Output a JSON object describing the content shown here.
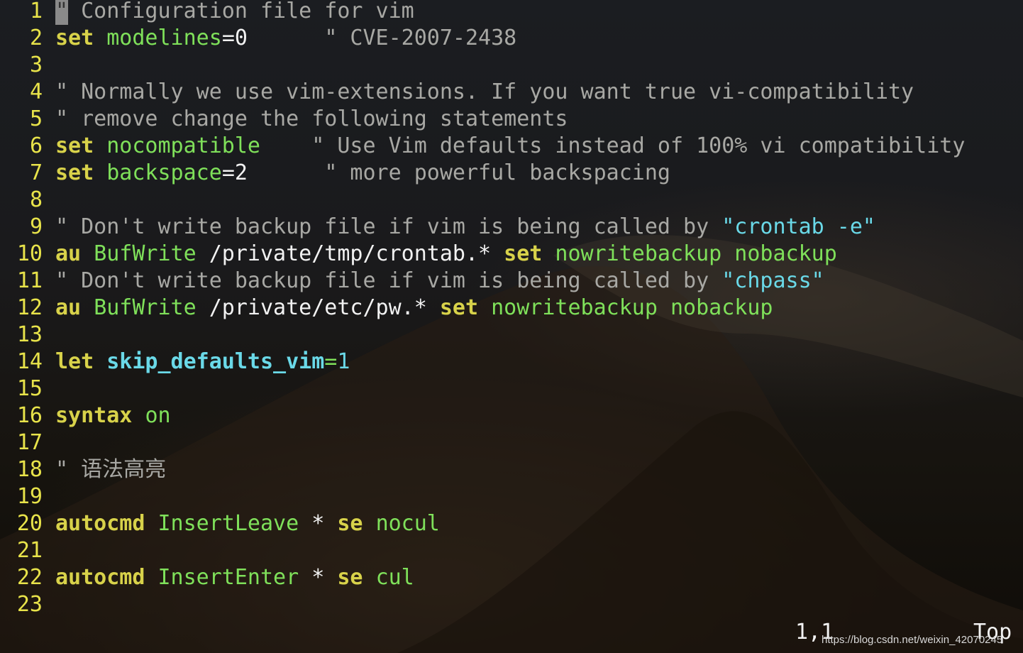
{
  "editor": {
    "lines": [
      {
        "n": "1",
        "tokens": [
          {
            "c": "cursor",
            "t": "\""
          },
          {
            "c": "cm",
            "t": " Configuration file for vim"
          }
        ]
      },
      {
        "n": "2",
        "tokens": [
          {
            "c": "kw",
            "t": "set"
          },
          {
            "c": "pl",
            "t": " "
          },
          {
            "c": "op",
            "t": "modelines"
          },
          {
            "c": "pl",
            "t": "=0      "
          },
          {
            "c": "cm",
            "t": "\" CVE-2007-2438"
          }
        ]
      },
      {
        "n": "3",
        "tokens": []
      },
      {
        "n": "4",
        "tokens": [
          {
            "c": "cm",
            "t": "\" Normally we use vim-extensions. If you want true vi-compatibility"
          }
        ]
      },
      {
        "n": "5",
        "tokens": [
          {
            "c": "cm",
            "t": "\" remove change the following statements"
          }
        ]
      },
      {
        "n": "6",
        "tokens": [
          {
            "c": "kw",
            "t": "set"
          },
          {
            "c": "pl",
            "t": " "
          },
          {
            "c": "op",
            "t": "nocompatible"
          },
          {
            "c": "pl",
            "t": "    "
          },
          {
            "c": "cm",
            "t": "\" Use Vim defaults instead of 100% vi compatibility"
          }
        ]
      },
      {
        "n": "7",
        "tokens": [
          {
            "c": "kw",
            "t": "set"
          },
          {
            "c": "pl",
            "t": " "
          },
          {
            "c": "op",
            "t": "backspace"
          },
          {
            "c": "pl",
            "t": "=2      "
          },
          {
            "c": "cm",
            "t": "\" more powerful backspacing"
          }
        ]
      },
      {
        "n": "8",
        "tokens": []
      },
      {
        "n": "9",
        "tokens": [
          {
            "c": "cm",
            "t": "\" Don't write backup file if vim is being called by "
          },
          {
            "c": "st",
            "t": "\"crontab -e\""
          }
        ]
      },
      {
        "n": "10",
        "tokens": [
          {
            "c": "kw",
            "t": "au"
          },
          {
            "c": "pl",
            "t": " "
          },
          {
            "c": "op",
            "t": "BufWrite"
          },
          {
            "c": "pl",
            "t": " /private/tmp/crontab.* "
          },
          {
            "c": "kw",
            "t": "set"
          },
          {
            "c": "pl",
            "t": " "
          },
          {
            "c": "op",
            "t": "nowritebackup nobackup"
          }
        ]
      },
      {
        "n": "11",
        "tokens": [
          {
            "c": "cm",
            "t": "\" Don't write backup file if vim is being called by "
          },
          {
            "c": "st",
            "t": "\"chpass\""
          }
        ]
      },
      {
        "n": "12",
        "tokens": [
          {
            "c": "kw",
            "t": "au"
          },
          {
            "c": "pl",
            "t": " "
          },
          {
            "c": "op",
            "t": "BufWrite"
          },
          {
            "c": "pl",
            "t": " /private/etc/pw.* "
          },
          {
            "c": "kw",
            "t": "set"
          },
          {
            "c": "pl",
            "t": " "
          },
          {
            "c": "op",
            "t": "nowritebackup nobackup"
          }
        ]
      },
      {
        "n": "13",
        "tokens": []
      },
      {
        "n": "14",
        "tokens": [
          {
            "c": "kw",
            "t": "let"
          },
          {
            "c": "pl",
            "t": " "
          },
          {
            "c": "cy",
            "t": "skip_defaults_vim"
          },
          {
            "c": "op",
            "t": "="
          },
          {
            "c": "st",
            "t": "1"
          }
        ]
      },
      {
        "n": "15",
        "tokens": []
      },
      {
        "n": "16",
        "tokens": [
          {
            "c": "kw",
            "t": "syntax"
          },
          {
            "c": "pl",
            "t": " "
          },
          {
            "c": "op",
            "t": "on"
          }
        ]
      },
      {
        "n": "17",
        "tokens": []
      },
      {
        "n": "18",
        "tokens": [
          {
            "c": "cm",
            "t": "\" 语法高亮"
          }
        ]
      },
      {
        "n": "19",
        "tokens": []
      },
      {
        "n": "20",
        "tokens": [
          {
            "c": "kw",
            "t": "autocmd"
          },
          {
            "c": "pl",
            "t": " "
          },
          {
            "c": "op",
            "t": "InsertLeave"
          },
          {
            "c": "pl",
            "t": " * "
          },
          {
            "c": "kw",
            "t": "se"
          },
          {
            "c": "pl",
            "t": " "
          },
          {
            "c": "op",
            "t": "nocul"
          }
        ]
      },
      {
        "n": "21",
        "tokens": []
      },
      {
        "n": "22",
        "tokens": [
          {
            "c": "kw",
            "t": "autocmd"
          },
          {
            "c": "pl",
            "t": " "
          },
          {
            "c": "op",
            "t": "InsertEnter"
          },
          {
            "c": "pl",
            "t": " * "
          },
          {
            "c": "kw",
            "t": "se"
          },
          {
            "c": "pl",
            "t": " "
          },
          {
            "c": "op",
            "t": "cul"
          }
        ]
      },
      {
        "n": "23",
        "tokens": []
      }
    ]
  },
  "status": {
    "position": "1,1",
    "scroll": "Top"
  },
  "watermark": "https://blog.csdn.net/weixin_42070245"
}
